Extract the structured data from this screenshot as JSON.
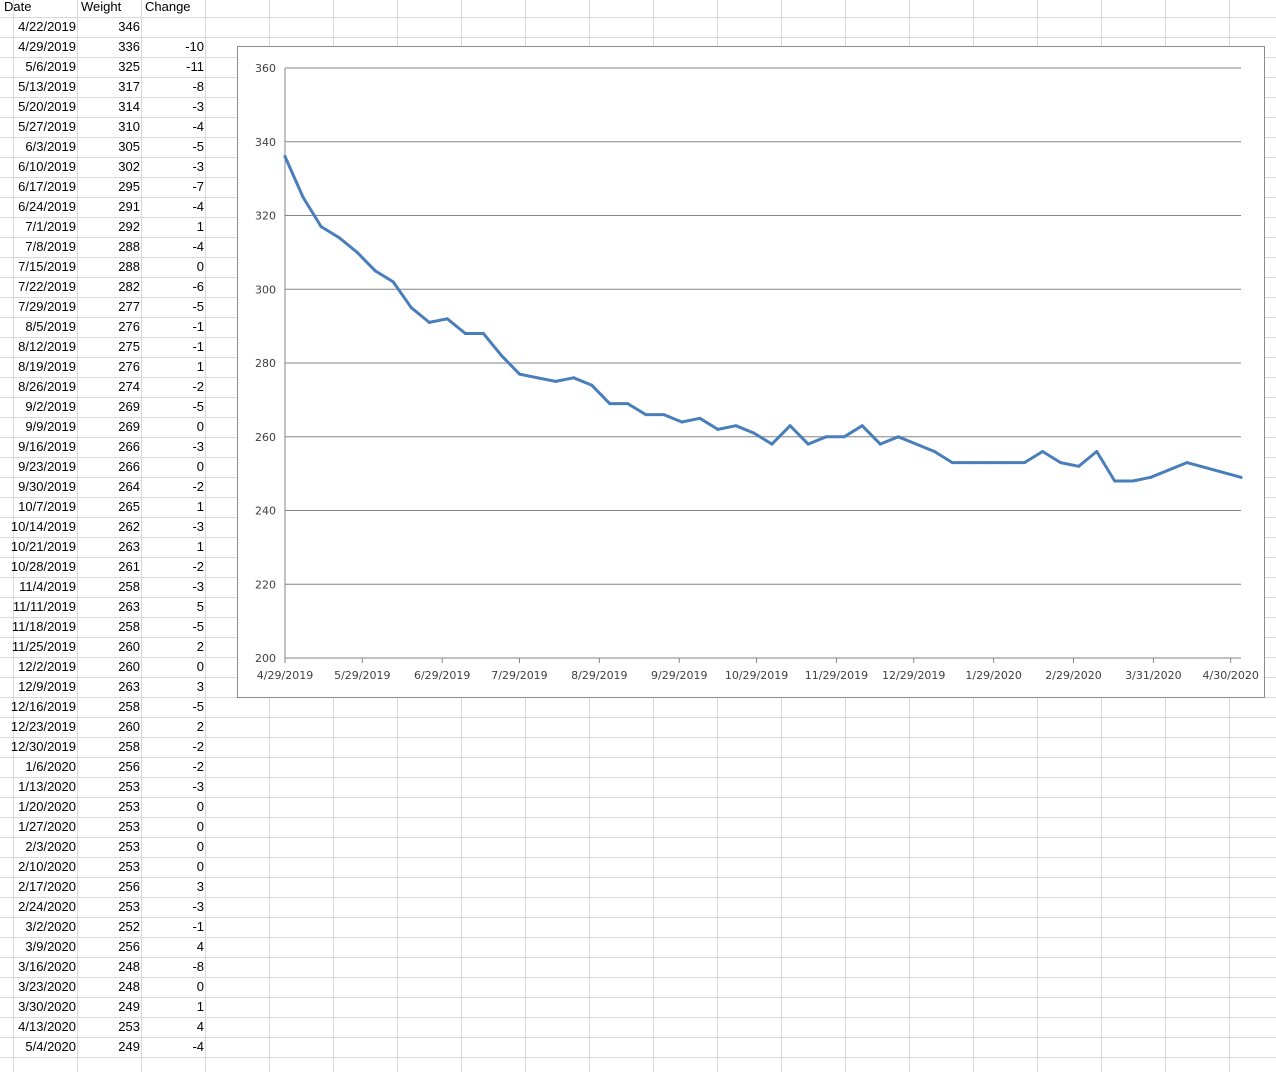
{
  "columns": {
    "date": "Date",
    "weight": "Weight",
    "change": "Change"
  },
  "rows": [
    {
      "date": "4/22/2019",
      "weight": "346",
      "change": ""
    },
    {
      "date": "4/29/2019",
      "weight": "336",
      "change": "-10"
    },
    {
      "date": "5/6/2019",
      "weight": "325",
      "change": "-11"
    },
    {
      "date": "5/13/2019",
      "weight": "317",
      "change": "-8"
    },
    {
      "date": "5/20/2019",
      "weight": "314",
      "change": "-3"
    },
    {
      "date": "5/27/2019",
      "weight": "310",
      "change": "-4"
    },
    {
      "date": "6/3/2019",
      "weight": "305",
      "change": "-5"
    },
    {
      "date": "6/10/2019",
      "weight": "302",
      "change": "-3"
    },
    {
      "date": "6/17/2019",
      "weight": "295",
      "change": "-7"
    },
    {
      "date": "6/24/2019",
      "weight": "291",
      "change": "-4"
    },
    {
      "date": "7/1/2019",
      "weight": "292",
      "change": "1"
    },
    {
      "date": "7/8/2019",
      "weight": "288",
      "change": "-4"
    },
    {
      "date": "7/15/2019",
      "weight": "288",
      "change": "0"
    },
    {
      "date": "7/22/2019",
      "weight": "282",
      "change": "-6"
    },
    {
      "date": "7/29/2019",
      "weight": "277",
      "change": "-5"
    },
    {
      "date": "8/5/2019",
      "weight": "276",
      "change": "-1"
    },
    {
      "date": "8/12/2019",
      "weight": "275",
      "change": "-1"
    },
    {
      "date": "8/19/2019",
      "weight": "276",
      "change": "1"
    },
    {
      "date": "8/26/2019",
      "weight": "274",
      "change": "-2"
    },
    {
      "date": "9/2/2019",
      "weight": "269",
      "change": "-5"
    },
    {
      "date": "9/9/2019",
      "weight": "269",
      "change": "0"
    },
    {
      "date": "9/16/2019",
      "weight": "266",
      "change": "-3"
    },
    {
      "date": "9/23/2019",
      "weight": "266",
      "change": "0"
    },
    {
      "date": "9/30/2019",
      "weight": "264",
      "change": "-2"
    },
    {
      "date": "10/7/2019",
      "weight": "265",
      "change": "1"
    },
    {
      "date": "10/14/2019",
      "weight": "262",
      "change": "-3"
    },
    {
      "date": "10/21/2019",
      "weight": "263",
      "change": "1"
    },
    {
      "date": "10/28/2019",
      "weight": "261",
      "change": "-2"
    },
    {
      "date": "11/4/2019",
      "weight": "258",
      "change": "-3"
    },
    {
      "date": "11/11/2019",
      "weight": "263",
      "change": "5"
    },
    {
      "date": "11/18/2019",
      "weight": "258",
      "change": "-5"
    },
    {
      "date": "11/25/2019",
      "weight": "260",
      "change": "2"
    },
    {
      "date": "12/2/2019",
      "weight": "260",
      "change": "0"
    },
    {
      "date": "12/9/2019",
      "weight": "263",
      "change": "3"
    },
    {
      "date": "12/16/2019",
      "weight": "258",
      "change": "-5"
    },
    {
      "date": "12/23/2019",
      "weight": "260",
      "change": "2"
    },
    {
      "date": "12/30/2019",
      "weight": "258",
      "change": "-2"
    },
    {
      "date": "1/6/2020",
      "weight": "256",
      "change": "-2"
    },
    {
      "date": "1/13/2020",
      "weight": "253",
      "change": "-3"
    },
    {
      "date": "1/20/2020",
      "weight": "253",
      "change": "0"
    },
    {
      "date": "1/27/2020",
      "weight": "253",
      "change": "0"
    },
    {
      "date": "2/3/2020",
      "weight": "253",
      "change": "0"
    },
    {
      "date": "2/10/2020",
      "weight": "253",
      "change": "0"
    },
    {
      "date": "2/17/2020",
      "weight": "256",
      "change": "3"
    },
    {
      "date": "2/24/2020",
      "weight": "253",
      "change": "-3"
    },
    {
      "date": "3/2/2020",
      "weight": "252",
      "change": "-1"
    },
    {
      "date": "3/9/2020",
      "weight": "256",
      "change": "4"
    },
    {
      "date": "3/16/2020",
      "weight": "248",
      "change": "-8"
    },
    {
      "date": "3/23/2020",
      "weight": "248",
      "change": "0"
    },
    {
      "date": "3/30/2020",
      "weight": "249",
      "change": "1"
    },
    {
      "date": "4/13/2020",
      "weight": "253",
      "change": "4"
    },
    {
      "date": "5/4/2020",
      "weight": "249",
      "change": "-4"
    }
  ],
  "chart_data": {
    "type": "line",
    "title": "",
    "xlabel": "",
    "ylabel": "",
    "ylim": [
      200,
      360
    ],
    "yticks": [
      200,
      220,
      240,
      260,
      280,
      300,
      320,
      340,
      360
    ],
    "xlim": [
      "2019-04-29",
      "2020-05-04"
    ],
    "xticks": [
      {
        "date": "2019-04-29",
        "label": "4/29/2019"
      },
      {
        "date": "2019-05-29",
        "label": "5/29/2019"
      },
      {
        "date": "2019-06-29",
        "label": "6/29/2019"
      },
      {
        "date": "2019-07-29",
        "label": "7/29/2019"
      },
      {
        "date": "2019-08-29",
        "label": "8/29/2019"
      },
      {
        "date": "2019-09-29",
        "label": "9/29/2019"
      },
      {
        "date": "2019-10-29",
        "label": "10/29/2019"
      },
      {
        "date": "2019-11-29",
        "label": "11/29/2019"
      },
      {
        "date": "2019-12-29",
        "label": "12/29/2019"
      },
      {
        "date": "2020-01-29",
        "label": "1/29/2020"
      },
      {
        "date": "2020-02-29",
        "label": "2/29/2020"
      },
      {
        "date": "2020-03-31",
        "label": "3/31/2020"
      },
      {
        "date": "2020-04-30",
        "label": "4/30/2020"
      }
    ],
    "grid": true,
    "series": [
      {
        "color": "#4a7ebb",
        "x": [
          "2019-04-29",
          "2019-05-06",
          "2019-05-13",
          "2019-05-20",
          "2019-05-27",
          "2019-06-03",
          "2019-06-10",
          "2019-06-17",
          "2019-06-24",
          "2019-07-01",
          "2019-07-08",
          "2019-07-15",
          "2019-07-22",
          "2019-07-29",
          "2019-08-05",
          "2019-08-12",
          "2019-08-19",
          "2019-08-26",
          "2019-09-02",
          "2019-09-09",
          "2019-09-16",
          "2019-09-23",
          "2019-09-30",
          "2019-10-07",
          "2019-10-14",
          "2019-10-21",
          "2019-10-28",
          "2019-11-04",
          "2019-11-11",
          "2019-11-18",
          "2019-11-25",
          "2019-12-02",
          "2019-12-09",
          "2019-12-16",
          "2019-12-23",
          "2019-12-30",
          "2020-01-06",
          "2020-01-13",
          "2020-01-20",
          "2020-01-27",
          "2020-02-03",
          "2020-02-10",
          "2020-02-17",
          "2020-02-24",
          "2020-03-02",
          "2020-03-09",
          "2020-03-16",
          "2020-03-23",
          "2020-03-30",
          "2020-04-13",
          "2020-05-04"
        ],
        "values": [
          336,
          325,
          317,
          314,
          310,
          305,
          302,
          295,
          291,
          292,
          288,
          288,
          282,
          277,
          276,
          275,
          276,
          274,
          269,
          269,
          266,
          266,
          264,
          265,
          262,
          263,
          261,
          258,
          263,
          258,
          260,
          260,
          263,
          258,
          260,
          258,
          256,
          253,
          253,
          253,
          253,
          253,
          256,
          253,
          252,
          256,
          248,
          248,
          249,
          253,
          249
        ]
      }
    ]
  }
}
